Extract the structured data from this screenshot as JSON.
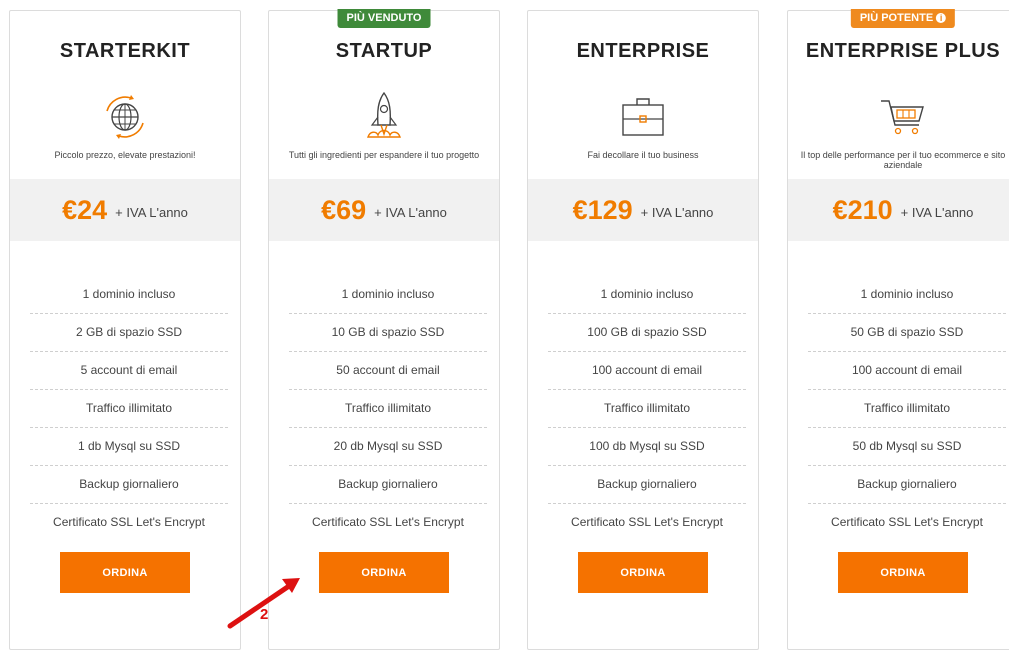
{
  "plans": [
    {
      "badge": "",
      "title": "STARTERKIT",
      "icon": "globe-icon",
      "tagline": "Piccolo prezzo, elevate prestazioni!",
      "price": "€24",
      "price_suffix": "+ IVA L'anno",
      "features": [
        "1 dominio incluso",
        "2 GB di spazio SSD",
        "5 account di email",
        "Traffico illimitato",
        "1 db Mysql su SSD",
        "Backup giornaliero",
        "Certificato SSL Let's Encrypt"
      ],
      "order_label": "ORDINA"
    },
    {
      "badge": "PIÙ VENDUTO",
      "title": "STARTUP",
      "icon": "rocket-icon",
      "tagline": "Tutti gli ingredienti per espandere il tuo progetto",
      "price": "€69",
      "price_suffix": "+ IVA L'anno",
      "features": [
        "1 dominio incluso",
        "10 GB di spazio SSD",
        "50 account di email",
        "Traffico illimitato",
        "20 db Mysql su SSD",
        "Backup giornaliero",
        "Certificato SSL Let's Encrypt"
      ],
      "order_label": "ORDINA"
    },
    {
      "badge": "",
      "title": "ENTERPRISE",
      "icon": "briefcase-icon",
      "tagline": "Fai decollare il tuo business",
      "price": "€129",
      "price_suffix": "+ IVA L'anno",
      "features": [
        "1 dominio incluso",
        "100 GB di spazio SSD",
        "100 account di email",
        "Traffico illimitato",
        "100 db Mysql su SSD",
        "Backup giornaliero",
        "Certificato SSL Let's Encrypt"
      ],
      "order_label": "ORDINA"
    },
    {
      "badge": "PIÙ POTENTE",
      "title": "ENTERPRISE PLUS",
      "icon": "shopping-cart-icon",
      "tagline": "Il top delle performance per il tuo ecommerce e sito aziendale",
      "price": "€210",
      "price_suffix": "+ IVA L'anno",
      "features": [
        "1 dominio incluso",
        "50 GB di spazio SSD",
        "100 account di email",
        "Traffico illimitato",
        "50 db Mysql su SSD",
        "Backup giornaliero",
        "Certificato SSL Let's Encrypt"
      ],
      "order_label": "ORDINA"
    }
  ],
  "annotation": {
    "number": "2",
    "color": "#dd1111"
  },
  "colors": {
    "accent": "#f57200",
    "badge_green": "#3f8a3a",
    "badge_orange": "#ef8a1e"
  }
}
